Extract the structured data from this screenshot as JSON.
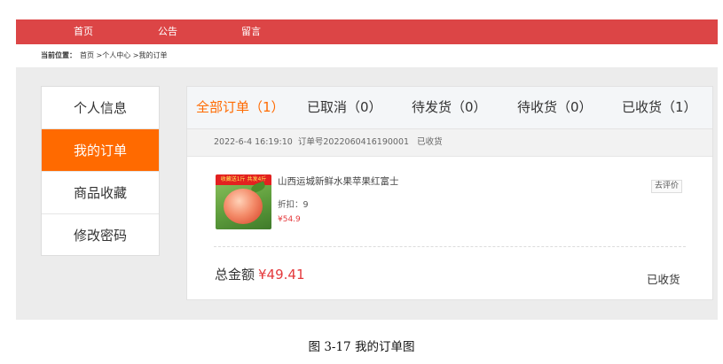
{
  "topnav": {
    "items": [
      "首页",
      "公告",
      "留言"
    ]
  },
  "breadcrumb": {
    "label": "当前位置：",
    "path": "首页 >个人中心 >我的订单"
  },
  "sidebar": {
    "items": [
      "个人信息",
      "我的订单",
      "商品收藏",
      "修改密码"
    ],
    "active_index": 1
  },
  "tabs": [
    "全部订单（1）",
    "已取消（0）",
    "待发货（0）",
    "待收货（0）",
    "已收货（1）"
  ],
  "order": {
    "time": "2022-6-4 16:19:10",
    "number": "订单号2022060416190001",
    "status": "已收货",
    "product": {
      "image_banner": "收藏送1斤 共发4斤",
      "name": "山西运城新鲜水果苹果红富士",
      "discount": "折扣：9",
      "price": "¥54.9"
    },
    "review_button": "去评价",
    "total_label": "总金额",
    "total_amount": "¥49.41",
    "footer_status": "已收货"
  },
  "caption": "图 3-17  我的订单图",
  "colors": {
    "nav_red": "#dc4546",
    "accent_orange": "#ff6a00",
    "price_red": "#e4393c",
    "panel_gray": "#ececec"
  }
}
